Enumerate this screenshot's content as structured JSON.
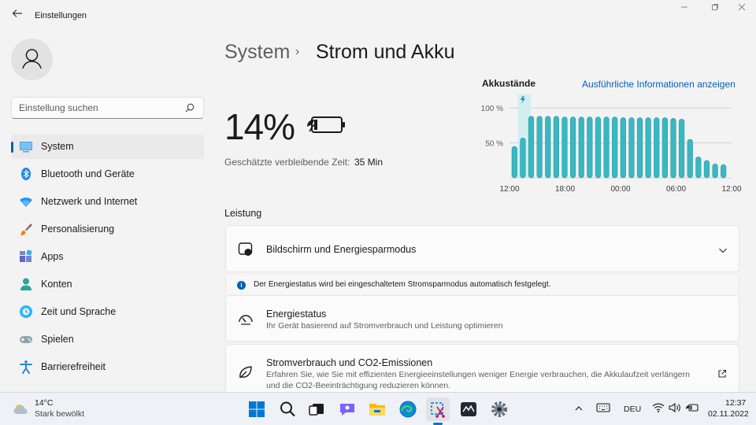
{
  "window": {
    "title": "Einstellungen",
    "icons": [
      "back-arrow-icon",
      "minimize-icon",
      "maximize-icon",
      "close-icon"
    ]
  },
  "sidebar": {
    "search_placeholder": "Einstellung suchen",
    "items": [
      {
        "label": "System",
        "icon": "system-icon",
        "active": true
      },
      {
        "label": "Bluetooth und Geräte",
        "icon": "bluetooth-icon"
      },
      {
        "label": "Netzwerk und Internet",
        "icon": "wifi-icon"
      },
      {
        "label": "Personalisierung",
        "icon": "brush-icon"
      },
      {
        "label": "Apps",
        "icon": "apps-icon"
      },
      {
        "label": "Konten",
        "icon": "person-icon"
      },
      {
        "label": "Zeit und Sprache",
        "icon": "globe-clock-icon"
      },
      {
        "label": "Spielen",
        "icon": "gamepad-icon"
      },
      {
        "label": "Barrierefreiheit",
        "icon": "accessibility-icon"
      }
    ]
  },
  "header": {
    "breadcrumb_parent": "System",
    "breadcrumb_sep": "›",
    "breadcrumb_current": "Strom und Akku"
  },
  "battery": {
    "percent": "14%",
    "remaining_label": "Geschätzte verbleibende Zeit:",
    "remaining_value": "35 Min"
  },
  "chart_data": {
    "type": "bar",
    "title": "Akkustände",
    "link": "Ausführliche Informationen anzeigen",
    "x_ticks": [
      "12:00",
      "18:00",
      "00:00",
      "06:00",
      "12:00"
    ],
    "y_ticks": [
      "100 %",
      "50 %"
    ],
    "ylim": [
      0,
      100
    ],
    "values": [
      45,
      57,
      88,
      88,
      88,
      88,
      87,
      87,
      87,
      87,
      87,
      87,
      87,
      86,
      86,
      86,
      86,
      86,
      86,
      85,
      84,
      55,
      30,
      25,
      20,
      19
    ],
    "charging_marker_index": 1,
    "bar_color": "#3bb7c2",
    "highlight_color": "#d3eef0"
  },
  "performance": {
    "heading": "Leistung",
    "screen_card": {
      "title": "Bildschirm und Energiesparmodus"
    },
    "info_text": "Der Energiestatus wird bei eingeschaltetem Stromsparmodus automatisch festgelegt.",
    "power_mode_card": {
      "title": "Energiestatus",
      "subtitle": "Ihr Gerät basierend auf Stromverbrauch und Leistung optimieren"
    },
    "co2_card": {
      "title": "Stromverbrauch und CO2-Emissionen",
      "subtitle_line1": "Erfahren Sie, wie Sie mit effizienten Energieeinstellungen weniger Energie verbrauchen, die Akkulaufzeit verlängern",
      "subtitle_line2": "und die CO2-Beeinträchtigung reduzieren können."
    }
  },
  "taskbar": {
    "weather_temp": "14°C",
    "weather_desc": "Stark bewölkt",
    "language": "DEU",
    "time": "12:37",
    "date": "02.11.2022",
    "apps": [
      "windows-start-icon",
      "search-icon",
      "task-view-icon",
      "chat-icon",
      "file-explorer-icon",
      "edge-icon",
      "snipping-tool-icon",
      "app-icon",
      "settings-gear-icon"
    ],
    "tray": [
      "chevron-up-icon",
      "keyboard-icon",
      "wifi-icon",
      "volume-icon",
      "battery-icon"
    ]
  },
  "colors": {
    "accent": "#005fb8",
    "background": "#f3f3f3",
    "card": "#fbfbfb"
  }
}
